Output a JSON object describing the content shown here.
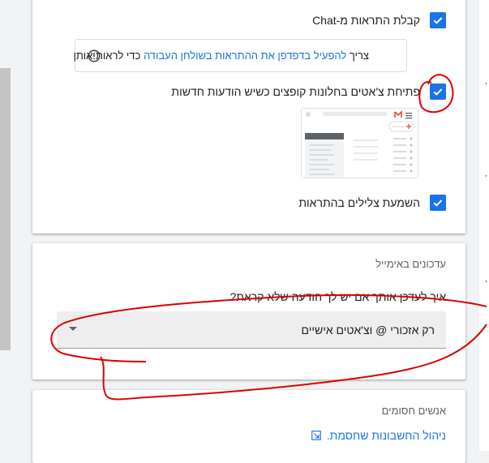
{
  "notifications": {
    "chat_label": "קבלת התראות מ-Chat",
    "info_prefix": "צריך ",
    "info_link": "להפעיל בדפדפן את ההתראות בשולחן העבודה",
    "info_suffix": " כדי לראות אותן",
    "popout_label": "פתיחת צ'אטים בחלונות קופצים כשיש הודעות חדשות",
    "sound_label": "השמעת צלילים בהתראות"
  },
  "email_updates": {
    "title": "עדכונים באימייל",
    "question": "איך לעדכן אותך אם יש לך הודעה שלא קראת?",
    "selected": "רק אזכורי @ וצ'אטים אישיים"
  },
  "blocked": {
    "title": "אנשים חסומים",
    "manage_link": "ניהול החשבונות שחסמת."
  },
  "colors": {
    "accent": "#1a73e8",
    "annotation": "#dd0000"
  }
}
